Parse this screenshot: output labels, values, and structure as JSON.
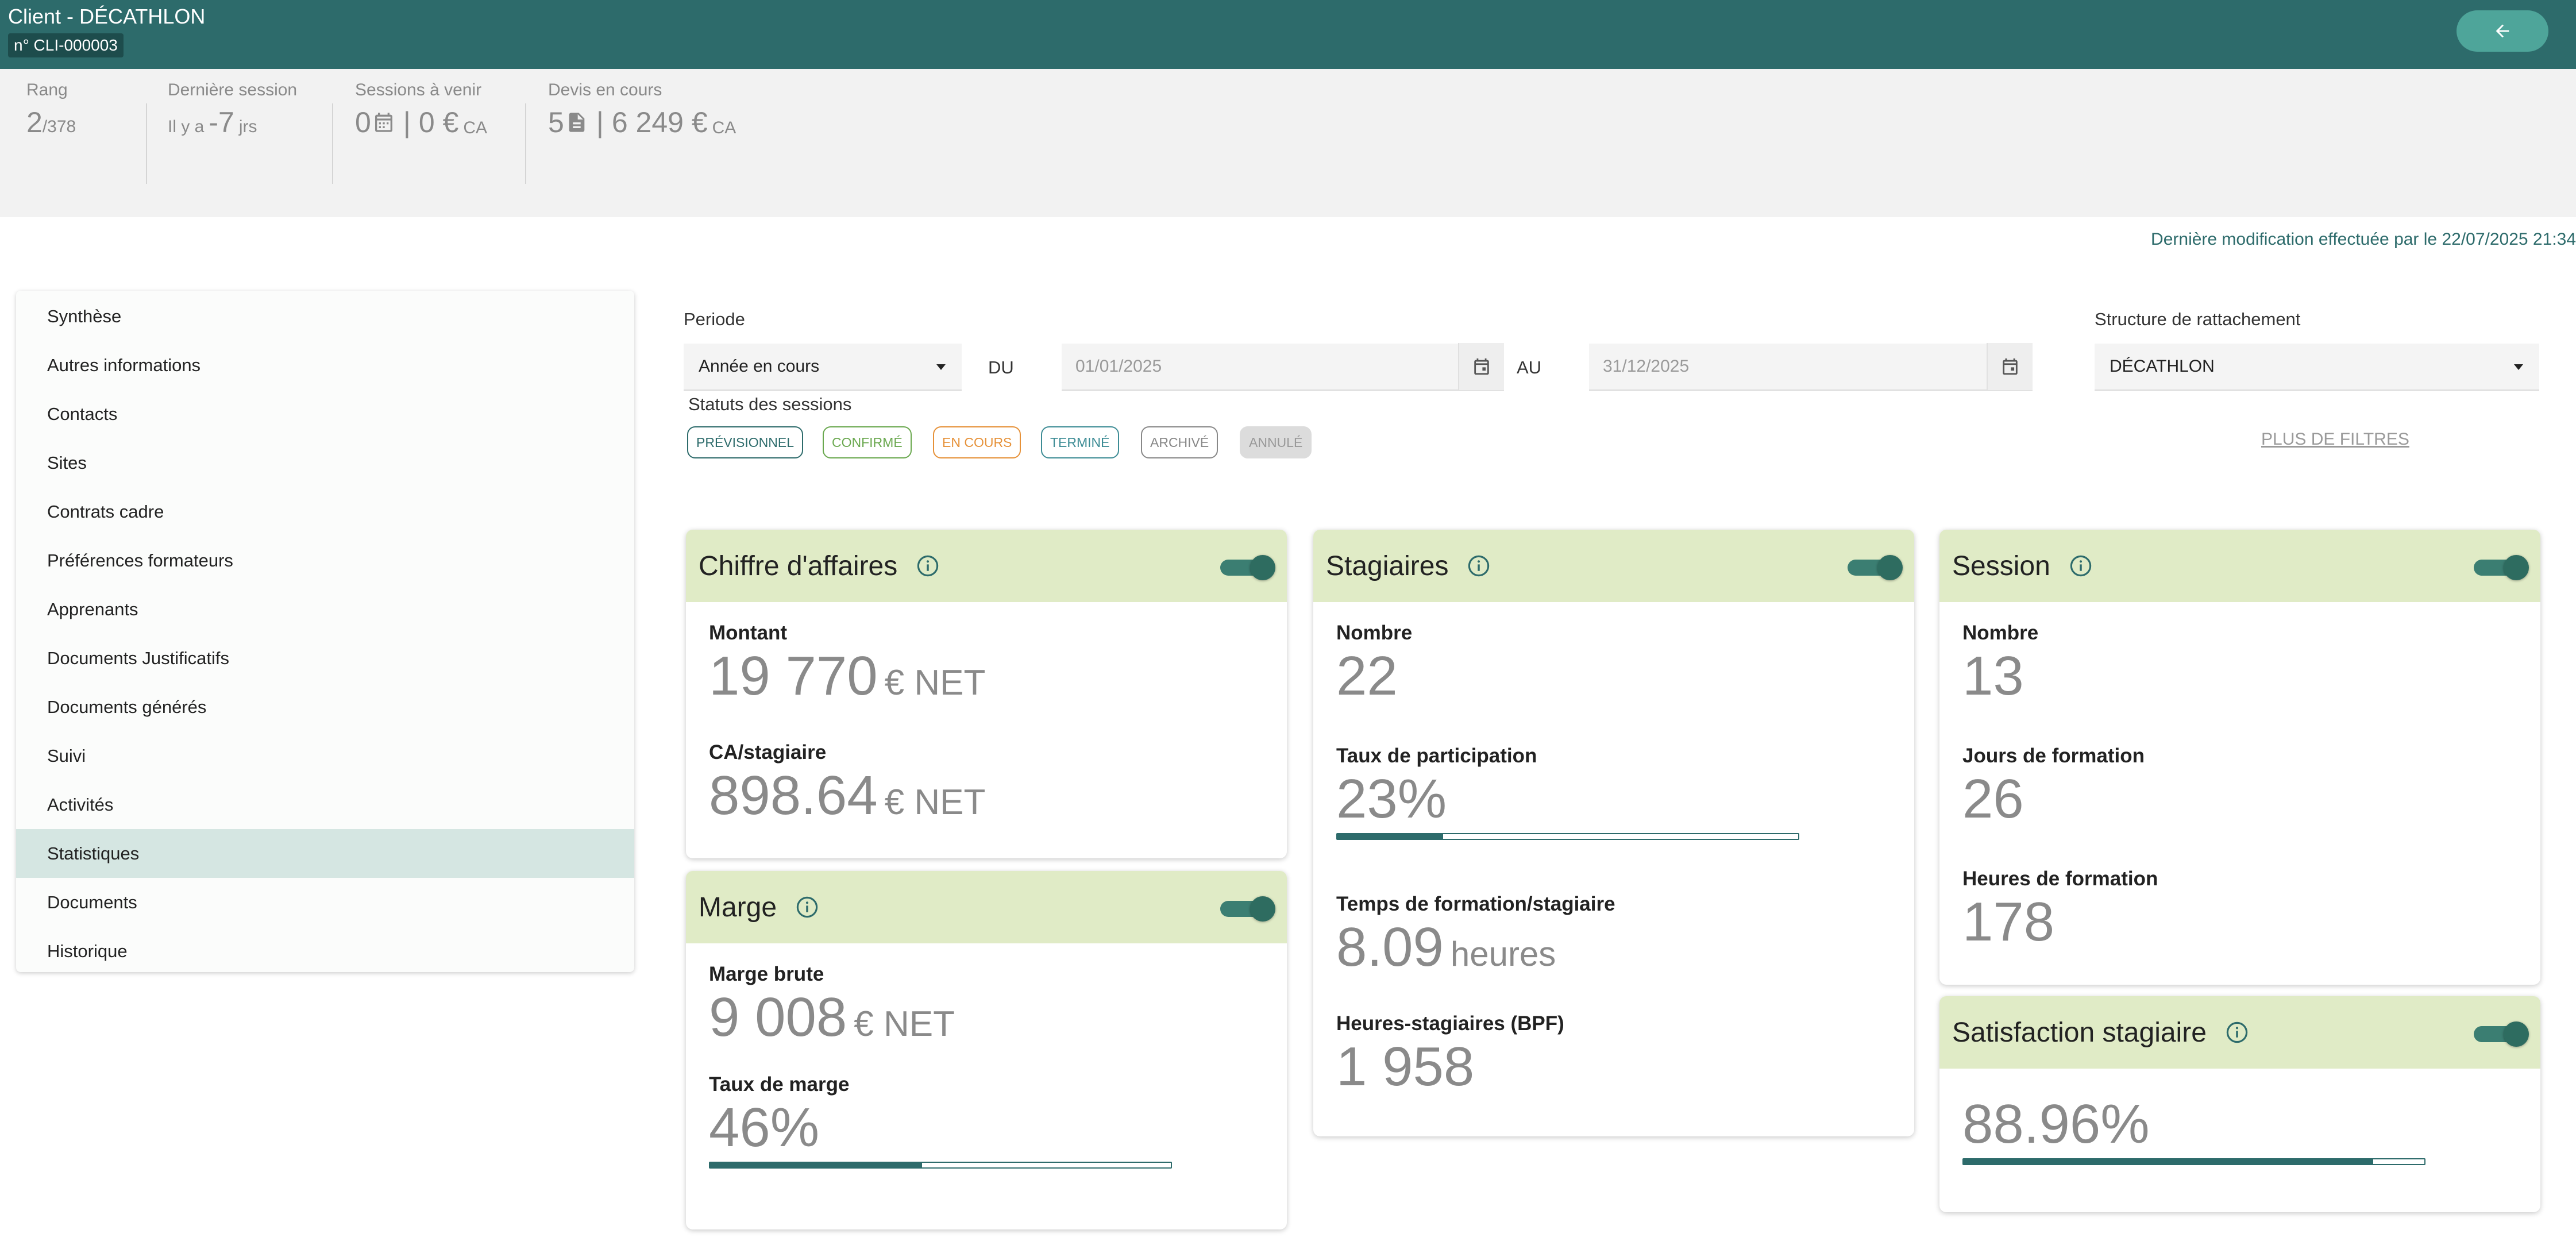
{
  "header": {
    "title": "Client - DÉCATHLON",
    "client_number": "n° CLI-000003",
    "back_icon": "arrow-left-icon"
  },
  "summary": {
    "rank": {
      "label": "Rang",
      "value": "2",
      "total": "/378"
    },
    "last_session": {
      "label": "Dernière session",
      "prefix": "Il y a",
      "value": "-7",
      "unit": "jrs"
    },
    "upcoming": {
      "label": "Sessions à venir",
      "count": "0",
      "separator": "|",
      "amount": "0 €",
      "unit": "CA",
      "icon": "calendar-icon"
    },
    "quotes": {
      "label": "Devis en cours",
      "count": "5",
      "separator": "|",
      "amount": "6 249 €",
      "unit": "CA",
      "icon": "document-icon"
    }
  },
  "last_modification": "Dernière modification effectuée par le 22/07/2025 21:34",
  "menu": [
    {
      "label": "Synthèse",
      "active": false
    },
    {
      "label": "Autres informations",
      "active": false
    },
    {
      "label": "Contacts",
      "active": false
    },
    {
      "label": "Sites",
      "active": false
    },
    {
      "label": "Contrats cadre",
      "active": false
    },
    {
      "label": "Préférences formateurs",
      "active": false
    },
    {
      "label": "Apprenants",
      "active": false
    },
    {
      "label": "Documents Justificatifs",
      "active": false
    },
    {
      "label": "Documents générés",
      "active": false
    },
    {
      "label": "Suivi",
      "active": false
    },
    {
      "label": "Activités",
      "active": false
    },
    {
      "label": "Statistiques",
      "active": true
    },
    {
      "label": "Documents",
      "active": false
    },
    {
      "label": "Historique",
      "active": false
    }
  ],
  "filters": {
    "period_label": "Periode",
    "period_value": "Année en cours",
    "du_label": "DU",
    "date_from": "01/01/2025",
    "au_label": "AU",
    "date_to": "31/12/2025",
    "structure_label": "Structure de rattachement",
    "structure_value": "DÉCATHLON",
    "statuses_label": "Statuts des sessions",
    "statuses": [
      {
        "label": "PRÉVISIONNEL",
        "color": "#2d6b6b"
      },
      {
        "label": "CONFIRMÉ",
        "color": "#6aa84f"
      },
      {
        "label": "EN COURS",
        "color": "#e69138"
      },
      {
        "label": "TERMINÉ",
        "color": "#3d8c95"
      },
      {
        "label": "ARCHIVÉ",
        "color": "#888888"
      },
      {
        "label": "ANNULÉ",
        "color": "#999999"
      }
    ],
    "more_filters": "PLUS DE FILTRES"
  },
  "cards": {
    "ca": {
      "title": "Chiffre d'affaires",
      "amount_label": "Montant",
      "amount_value": "19 770",
      "amount_unit": "€ NET",
      "per_trainee_label": "CA/stagiaire",
      "per_trainee_value": "898.64",
      "per_trainee_unit": "€ NET"
    },
    "marge": {
      "title": "Marge",
      "gross_label": "Marge brute",
      "gross_value": "9 008",
      "gross_unit": "€ NET",
      "rate_label": "Taux de marge",
      "rate_value": "46%",
      "rate_fraction": 0.46
    },
    "stagiaires": {
      "title": "Stagiaires",
      "count_label": "Nombre",
      "count_value": "22",
      "participation_label": "Taux de participation",
      "participation_value": "23%",
      "participation_fraction": 0.23,
      "time_label": "Temps de formation/stagiaire",
      "time_value": "8.09",
      "time_unit": "heures",
      "hours_label": "Heures-stagiaires (BPF)",
      "hours_value": "1 958"
    },
    "session": {
      "title": "Session",
      "count_label": "Nombre",
      "count_value": "13",
      "days_label": "Jours de formation",
      "days_value": "26",
      "hours_label": "Heures de formation",
      "hours_value": "178"
    },
    "satisfaction": {
      "title": "Satisfaction stagiaire",
      "value": "88.96%",
      "fraction": 0.8896
    }
  },
  "colors": {
    "primary": "#2d6b6b",
    "card_header": "#e0ebc6",
    "active_menu": "#d5e6e2"
  }
}
